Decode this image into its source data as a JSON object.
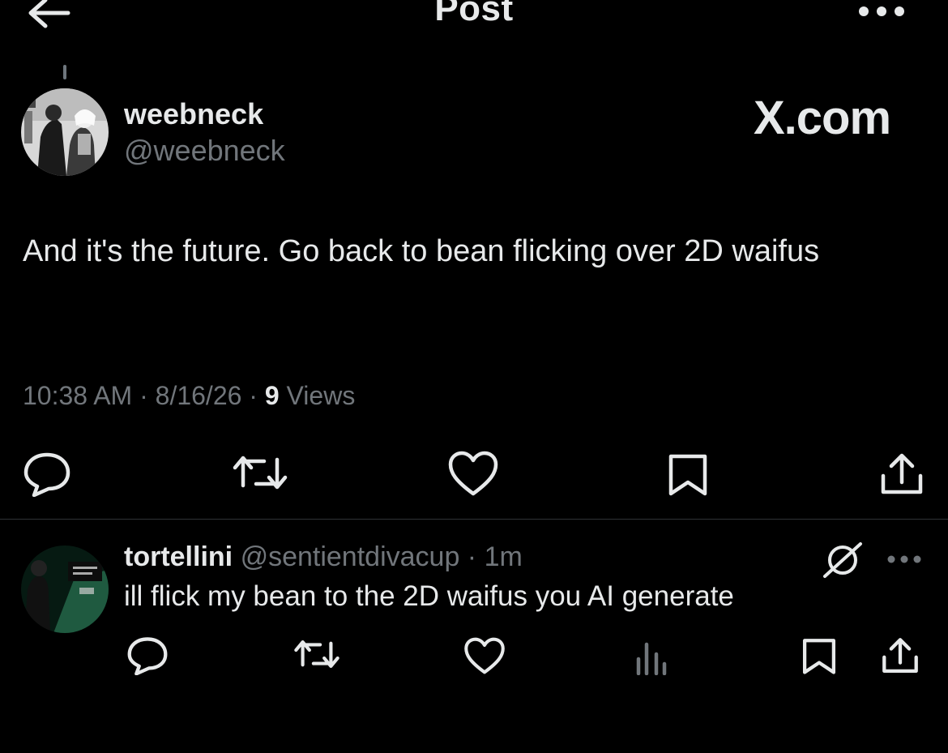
{
  "header": {
    "title": "Post",
    "back_icon": "arrow-left-icon",
    "more_icon": "more-horizontal-icon"
  },
  "watermark": "X.com",
  "main_post": {
    "display_name": "weebneck",
    "handle": "@weebneck",
    "text": "And it's the future. Go back to bean flicking over 2D waifus",
    "time": "10:38 AM",
    "date": "8/16/26",
    "views_count": "9",
    "views_label": "Views",
    "actions": [
      "reply-icon",
      "retweet-icon",
      "like-icon",
      "bookmark-icon",
      "share-icon"
    ]
  },
  "reply": {
    "display_name": "tortellini",
    "handle": "@sentientdivacup",
    "time": "1m",
    "text": "ill flick my bean to the 2D waifus you AI generate",
    "actions": [
      "reply-icon",
      "retweet-icon",
      "like-icon",
      "views-icon",
      "bookmark-icon",
      "share-icon"
    ]
  },
  "colors": {
    "background": "#000000",
    "text_primary": "#e7e9ea",
    "text_secondary": "#71767b",
    "divider": "#2f3336"
  }
}
